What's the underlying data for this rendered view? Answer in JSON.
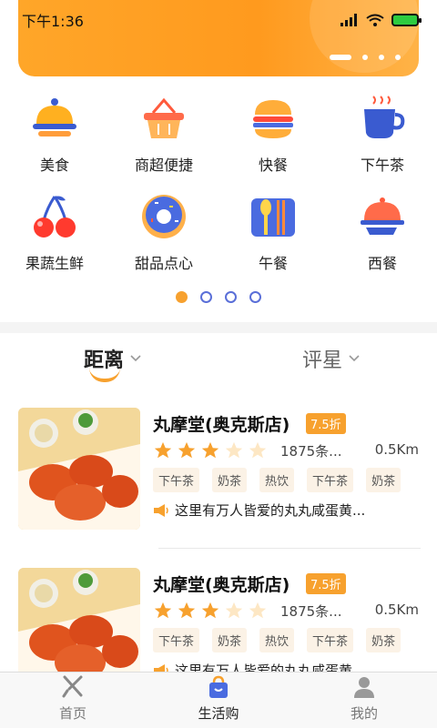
{
  "status": {
    "time": "下午1:36"
  },
  "categories": [
    {
      "label": "美食",
      "icon": "food-cloche-icon"
    },
    {
      "label": "商超便捷",
      "icon": "basket-icon"
    },
    {
      "label": "快餐",
      "icon": "burger-icon"
    },
    {
      "label": "下午茶",
      "icon": "teacup-icon"
    },
    {
      "label": "果蔬生鲜",
      "icon": "cherry-icon"
    },
    {
      "label": "甜品点心",
      "icon": "donut-icon"
    },
    {
      "label": "午餐",
      "icon": "cutlery-icon"
    },
    {
      "label": "西餐",
      "icon": "serving-tray-icon"
    }
  ],
  "sort": {
    "distance": "距离",
    "rating": "评星"
  },
  "stores": [
    {
      "name": "丸摩堂(奥克斯店)",
      "discount": "7.5折",
      "rating": 3,
      "review_count": "1875条...",
      "distance": "0.5Km",
      "tags": [
        "下午茶",
        "奶茶",
        "热饮",
        "下午茶",
        "奶茶"
      ],
      "notice": "这里有万人皆爱的丸丸咸蛋黄..."
    },
    {
      "name": "丸摩堂(奥克斯店)",
      "discount": "7.5折",
      "rating": 3,
      "review_count": "1875条...",
      "distance": "0.5Km",
      "tags": [
        "下午茶",
        "奶茶",
        "热饮",
        "下午茶",
        "奶茶"
      ],
      "notice": "这里有万人皆爱的丸丸咸蛋黄..."
    }
  ],
  "tabbar": [
    {
      "label": "首页",
      "icon": "fork-knife-icon"
    },
    {
      "label": "生活购",
      "icon": "shopping-bag-icon"
    },
    {
      "label": "我的",
      "icon": "user-icon"
    }
  ],
  "colors": {
    "accent": "#f7a12e",
    "dot_inactive": "#5a6fd8"
  }
}
